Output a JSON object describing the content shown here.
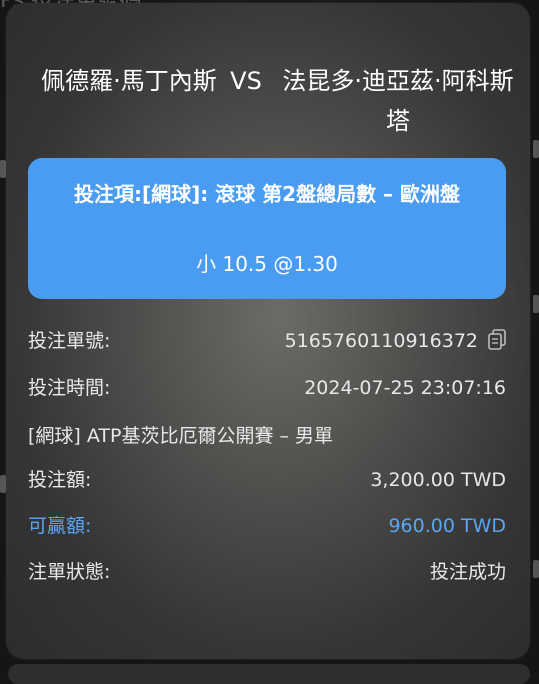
{
  "background": {
    "header_text": "Ps 投注單號碼"
  },
  "match": {
    "home": "佩德羅·馬丁內斯",
    "vs": "VS",
    "away": "法昆多·迪亞茲·阿科斯塔"
  },
  "bet": {
    "title": "投注項:[網球]: 滾球 第2盤總局數 – 歐洲盤",
    "selection": "小 10.5 @1.30",
    "box_color": "#4a9cf3"
  },
  "details": {
    "bet_no_label": "投注單號:",
    "bet_no_value": "5165760110916372",
    "copy_icon": "copy-icon",
    "bet_time_label": "投注時間:",
    "bet_time_value": "2024-07-25 23:07:16",
    "league": "[網球] ATP基茨比厄爾公開賽 – 男單",
    "stake_label": "投注額:",
    "stake_value": "3,200.00 TWD",
    "win_label": "可贏額:",
    "win_value": "960.00 TWD",
    "win_color": "#5aa6f5",
    "status_label": "注單狀態:",
    "status_value": "投注成功"
  }
}
